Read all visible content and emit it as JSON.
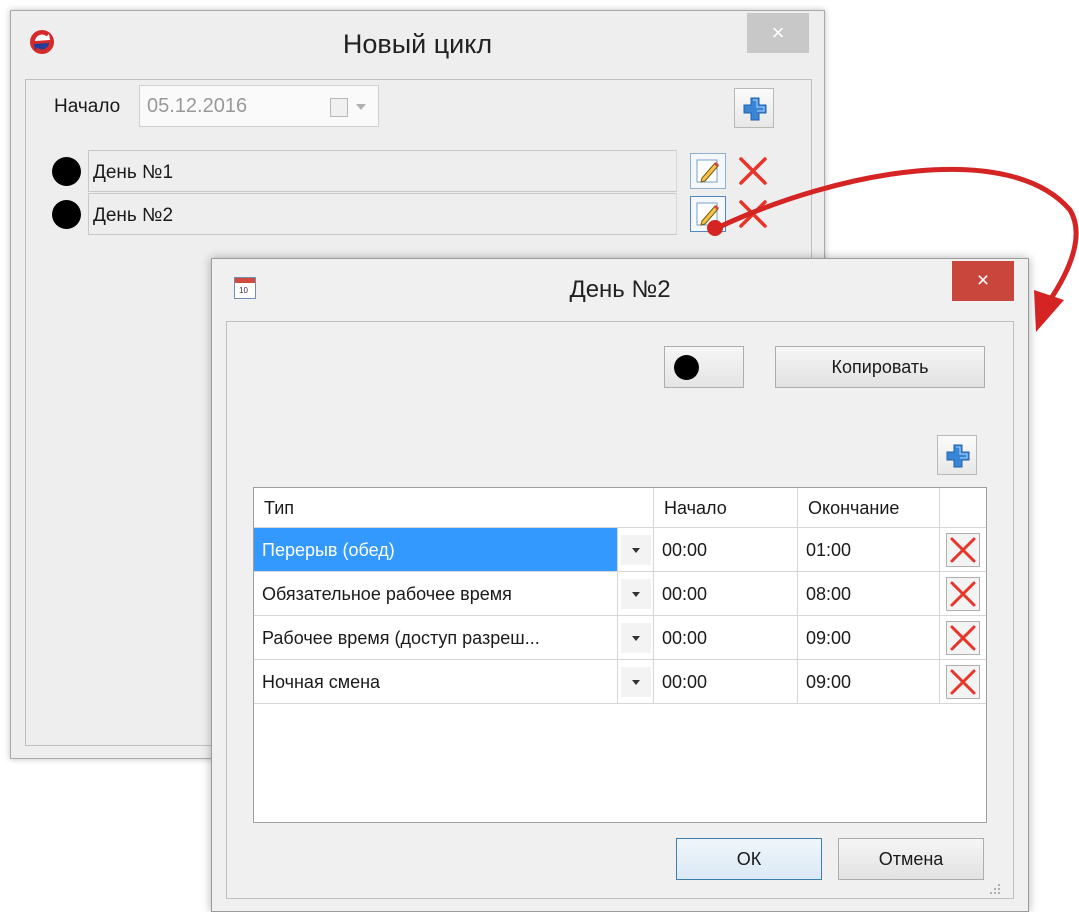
{
  "back_window": {
    "title": "Новый цикл",
    "close_label": "×",
    "start_label": "Начало",
    "start_date": "05.12.2016",
    "days": [
      {
        "label": "День №1"
      },
      {
        "label": "День №2"
      }
    ]
  },
  "day_dialog": {
    "title": "День №2",
    "close_label": "×",
    "copy_button": "Копировать",
    "columns": {
      "type": "Тип",
      "start": "Начало",
      "end": "Окончание"
    },
    "rows": [
      {
        "type": "Перерыв (обед)",
        "start": "00:00",
        "end": "01:00"
      },
      {
        "type": "Обязательное рабочее время",
        "start": "00:00",
        "end": "08:00"
      },
      {
        "type": "Рабочее время (доступ разреш...",
        "start": "00:00",
        "end": "09:00"
      },
      {
        "type": "Ночная смена",
        "start": "00:00",
        "end": "09:00"
      }
    ],
    "ok_button": "ОК",
    "cancel_button": "Отмена"
  },
  "colors": {
    "accent_blue": "#3399ff",
    "delete_red": "#e8352a",
    "arrow_red": "#d42424",
    "close_active": "#c9463d"
  },
  "icons": [
    "app-logo-icon",
    "calendar-icon",
    "plus-icon",
    "pencil-icon",
    "delete-x-icon",
    "close-icon",
    "calendar-dialog-icon",
    "resize-grip-icon"
  ]
}
